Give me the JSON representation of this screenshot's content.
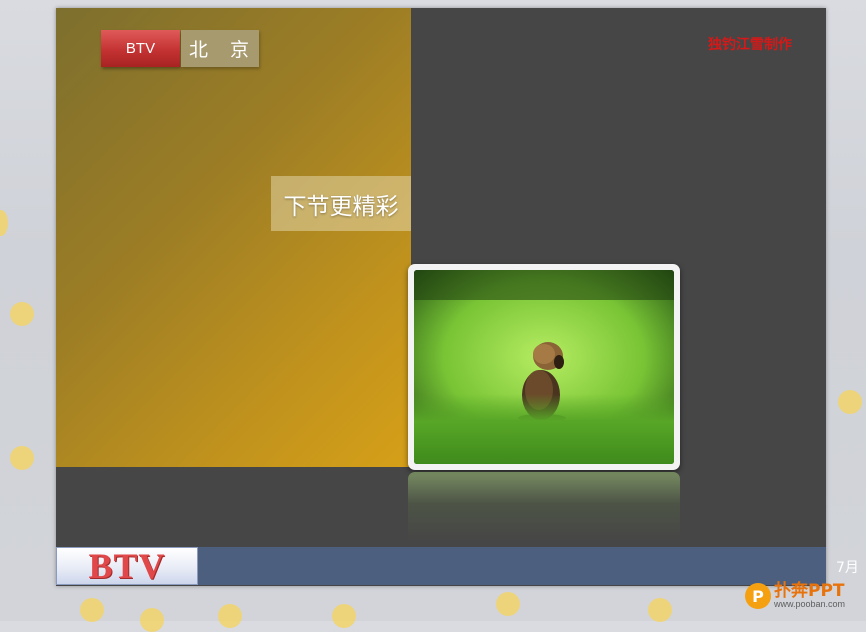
{
  "slide": {
    "tab_btv": "BTV",
    "tab_beijing": "北 京",
    "teaser": "下节更精彩",
    "credit": "独钓江雪制作",
    "footer_logo": "BTV",
    "footer_date": "7月"
  },
  "watermark": {
    "title": "扑奔PPT",
    "url": "www.pooban.com",
    "icon_glyph": "P"
  },
  "colors": {
    "slide_bg": "#464646",
    "gold_panel": "#c1931d",
    "btv_red": "#c43232",
    "footer_bar": "#4d5f7e",
    "credit_red": "#d61818"
  }
}
